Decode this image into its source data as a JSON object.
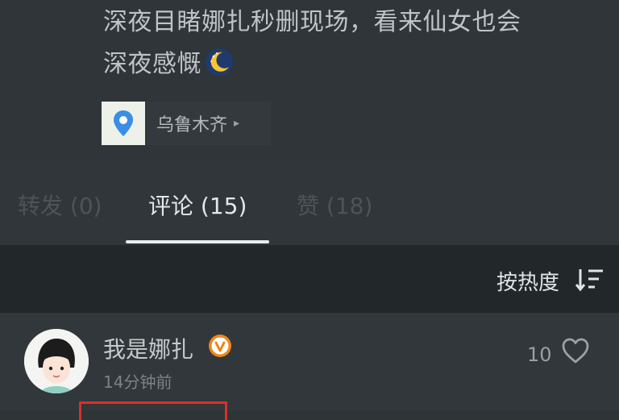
{
  "post": {
    "text_line1": "深夜目睹娜扎秒删现场，看来仙女也会",
    "text_line2": "深夜感慨",
    "emoji": "crescent-moon-icon",
    "location": "乌鲁木齐",
    "location_chevron": "▸"
  },
  "tabs": [
    {
      "label": "转发 (0)",
      "active": false
    },
    {
      "label": "评论 (15)",
      "active": true
    },
    {
      "label": "赞 (18)",
      "active": false
    }
  ],
  "sort": {
    "label": "按热度",
    "icon": "sort-icon"
  },
  "comment": {
    "username": "我是娜扎",
    "verified_icon": "verified-badge-icon",
    "timestamp": "14分钟前",
    "likes": "10",
    "like_icon": "heart-outline-icon"
  },
  "colors": {
    "background": "#2f3437",
    "sort_bar": "#222729",
    "active_tab": "#e4e7e9",
    "inactive_tab": "#4d5458",
    "verified": "#f08519",
    "highlight": "#d9302c"
  }
}
